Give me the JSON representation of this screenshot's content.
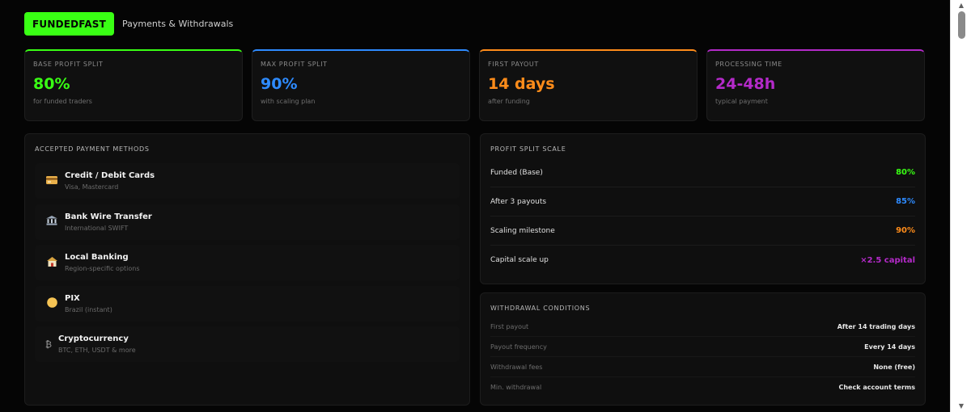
{
  "header": {
    "logo": "FUNDEDFAST",
    "title": "Payments & Withdrawals"
  },
  "stats": [
    {
      "label": "BASE PROFIT SPLIT",
      "value": "80%",
      "sub": "for funded traders",
      "color": "#39ff14"
    },
    {
      "label": "MAX PROFIT SPLIT",
      "value": "90%",
      "sub": "with scaling plan",
      "color": "#2e8bff"
    },
    {
      "label": "FIRST PAYOUT",
      "value": "14 days",
      "sub": "after funding",
      "color": "#ff8c1a"
    },
    {
      "label": "PROCESSING TIME",
      "value": "24-48h",
      "sub": "typical payment",
      "color": "#b42ac9"
    }
  ],
  "methods": {
    "title": "ACCEPTED PAYMENT METHODS",
    "items": [
      {
        "icon": "credit-card-icon",
        "name": "Credit / Debit Cards",
        "desc": "Visa, Mastercard"
      },
      {
        "icon": "bank-icon",
        "name": "Bank Wire Transfer",
        "desc": "International SWIFT"
      },
      {
        "icon": "local-bank-icon",
        "name": "Local Banking",
        "desc": "Region-specific options"
      },
      {
        "icon": "pix-icon",
        "name": "PIX",
        "desc": "Brazil (instant)"
      },
      {
        "icon": "bitcoin-icon",
        "name": "Cryptocurrency",
        "desc": "BTC, ETH, USDT & more"
      }
    ]
  },
  "scale": {
    "title": "PROFIT SPLIT SCALE",
    "rows": [
      {
        "label": "Funded (Base)",
        "value": "80%",
        "color": "#39ff14"
      },
      {
        "label": "After 3 payouts",
        "value": "85%",
        "color": "#2e8bff"
      },
      {
        "label": "Scaling milestone",
        "value": "90%",
        "color": "#ff8c1a"
      },
      {
        "label": "Capital scale up",
        "value": "×2.5 capital",
        "color": "#b42ac9"
      }
    ]
  },
  "conditions": {
    "title": "WITHDRAWAL CONDITIONS",
    "rows": [
      {
        "label": "First payout",
        "value": "After 14 trading days"
      },
      {
        "label": "Payout frequency",
        "value": "Every 14 days"
      },
      {
        "label": "Withdrawal fees",
        "value": "None (free)"
      },
      {
        "label": "Min. withdrawal",
        "value": "Check account terms"
      }
    ]
  }
}
